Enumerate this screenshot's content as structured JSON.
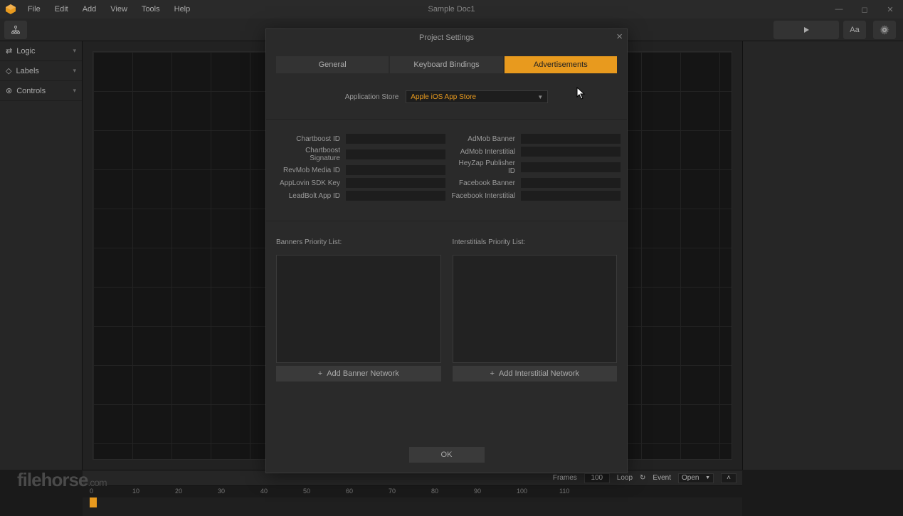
{
  "title": "Sample Doc1",
  "menus": [
    "File",
    "Edit",
    "Add",
    "View",
    "Tools",
    "Help"
  ],
  "sidebar": [
    {
      "icon": "⚞",
      "label": "Logic"
    },
    {
      "icon": "◈",
      "label": "Labels"
    },
    {
      "icon": "◉",
      "label": "Controls"
    }
  ],
  "dialog": {
    "title": "Project Settings",
    "tabs": [
      "General",
      "Keyboard Bindings",
      "Advertisements"
    ],
    "store_label": "Application Store",
    "store_value": "Apple iOS App Store",
    "left_fields": [
      "Chartboost ID",
      "Chartboost Signature",
      "RevMob Media ID",
      "AppLovin SDK Key",
      "LeadBolt App ID"
    ],
    "right_fields": [
      "AdMob Banner",
      "AdMob Interstitial",
      "HeyZap Publisher ID",
      "Facebook Banner",
      "Facebook Interstitial"
    ],
    "banners_label": "Banners Priority List:",
    "inter_label": "Interstitials Priority List:",
    "add_banner": "Add Banner Network",
    "add_inter": "Add Interstitial Network",
    "ok": "OK"
  },
  "timeline": {
    "frames_label": "Frames",
    "frames_value": "100",
    "loop_label": "Loop",
    "event_label": "Event",
    "event_value": "Open",
    "ticks": [
      "0",
      "10",
      "20",
      "30",
      "40",
      "50",
      "60",
      "70",
      "80",
      "90",
      "100",
      "110"
    ]
  },
  "watermark": "filehorse",
  "watermark_suffix": ".com"
}
